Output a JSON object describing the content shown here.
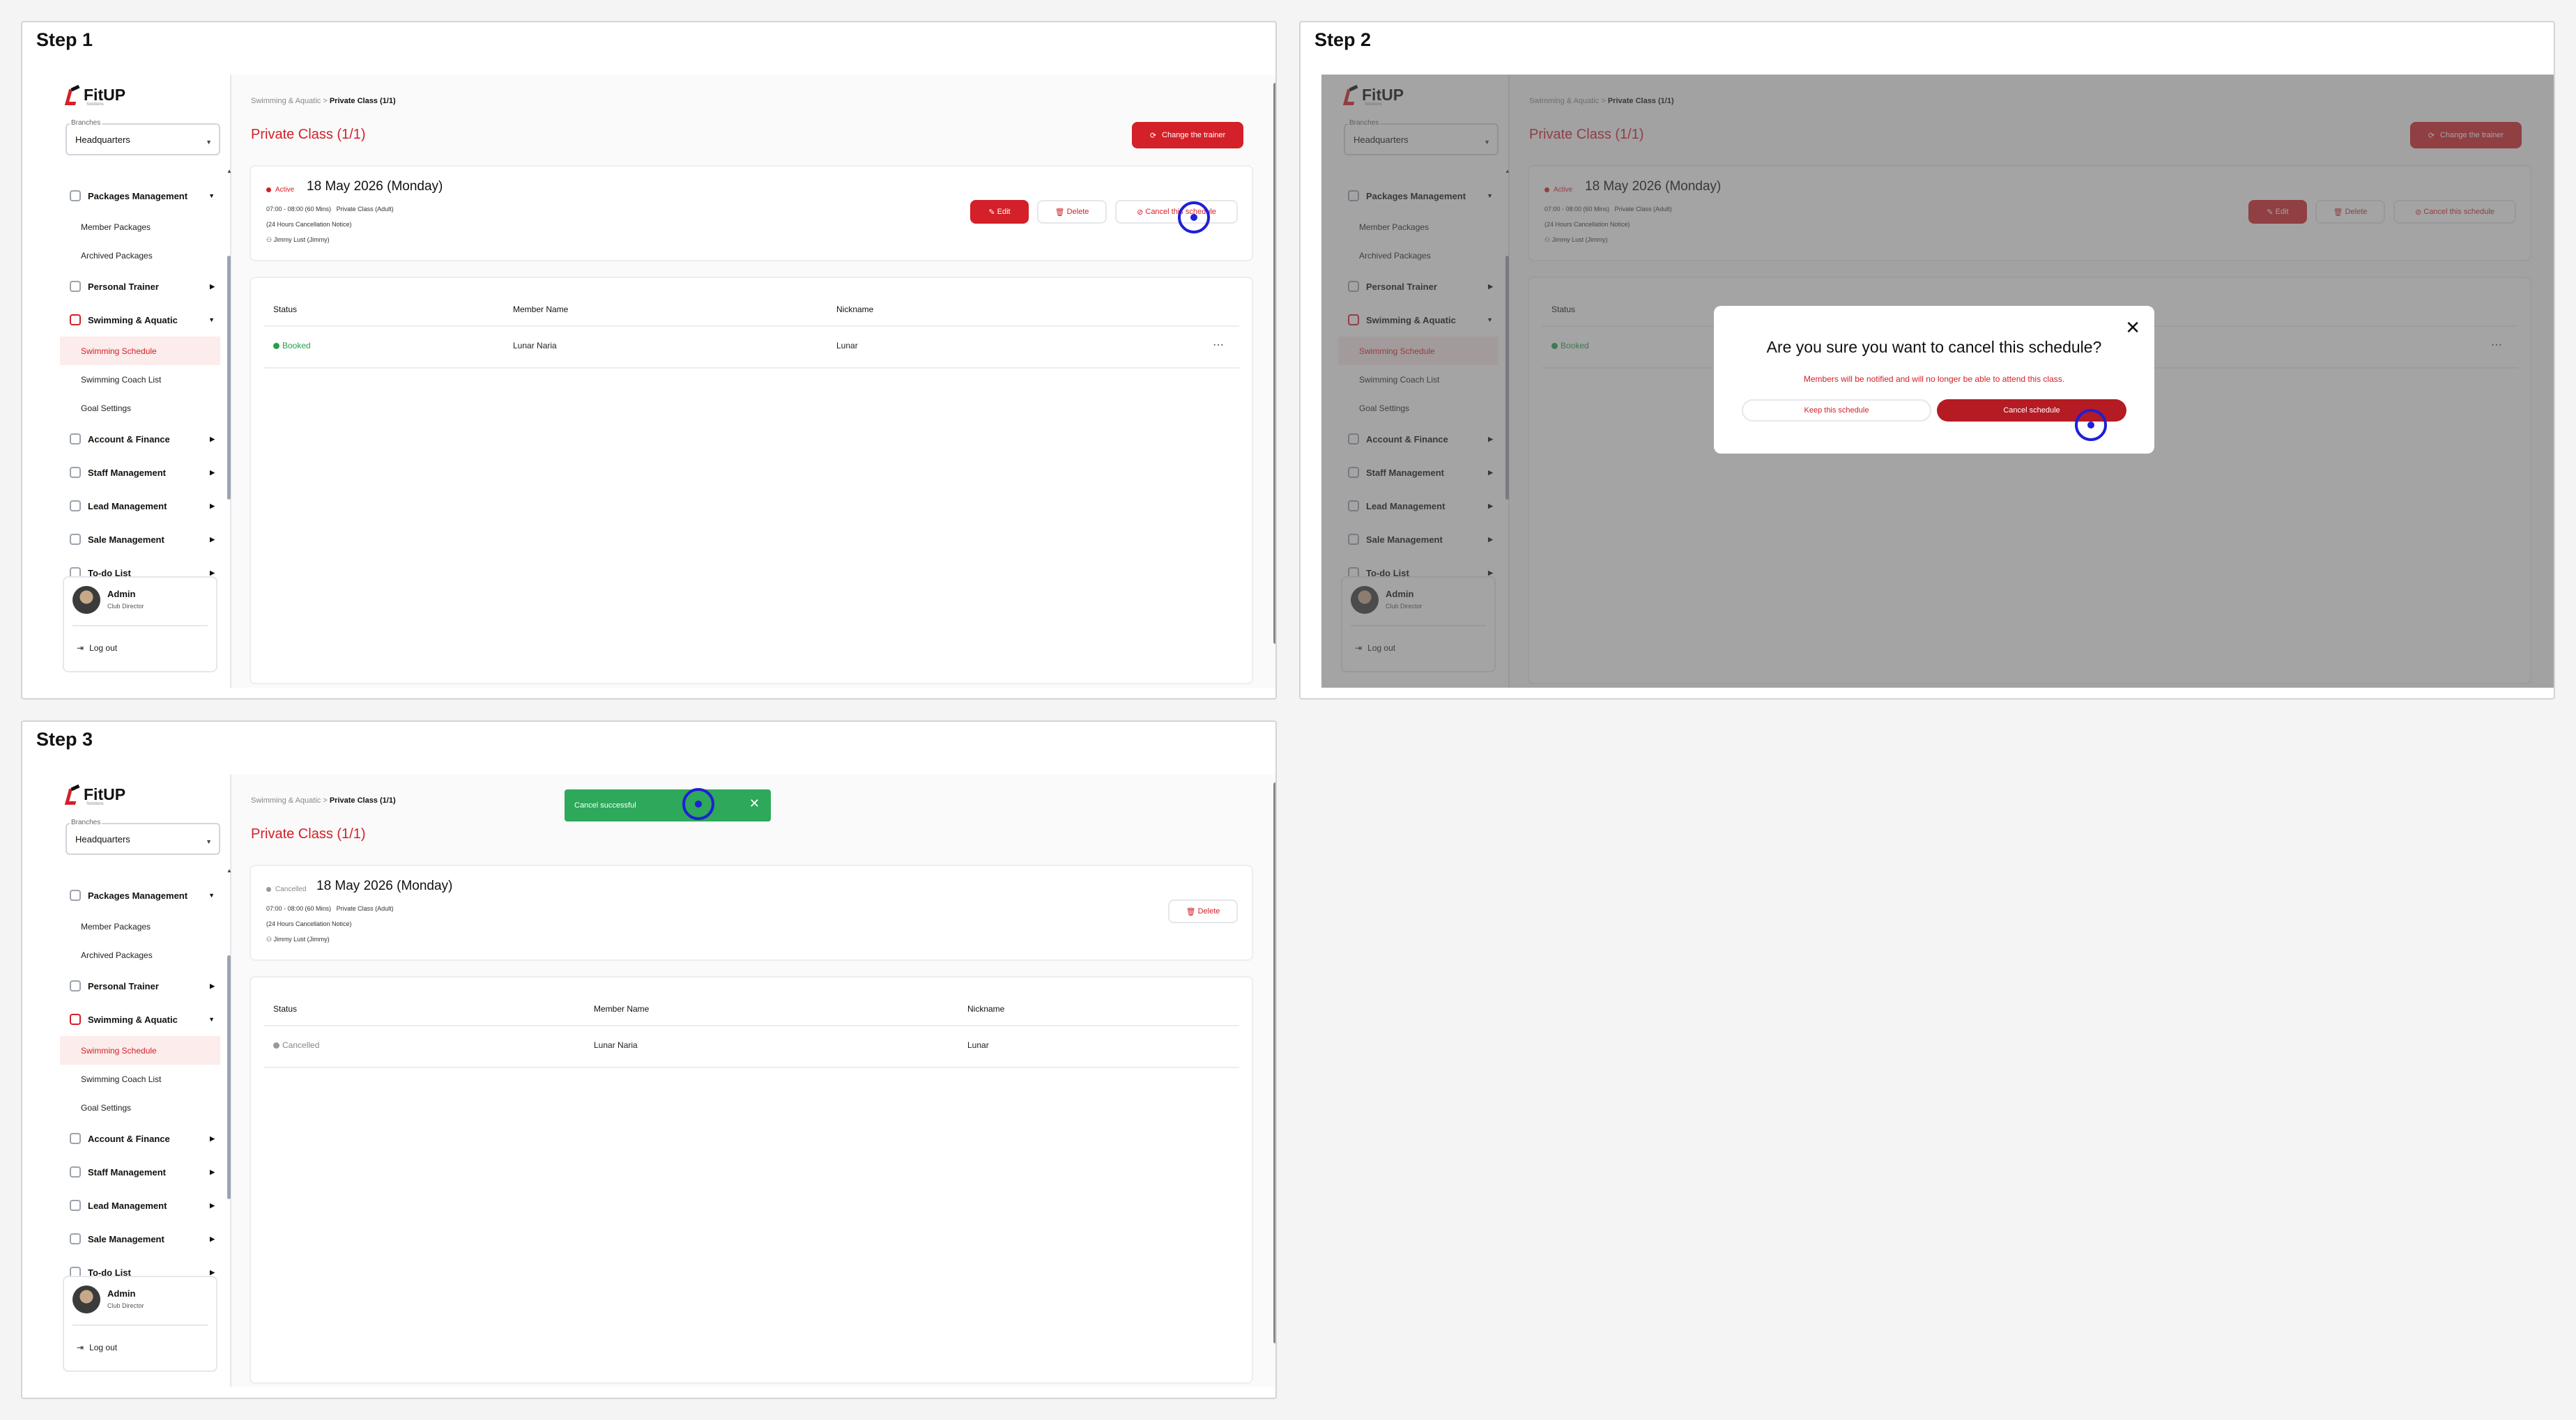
{
  "steps": [
    {
      "title": "Step 1"
    },
    {
      "title": "Step 2"
    },
    {
      "title": "Step 3"
    }
  ],
  "brand": {
    "name": "FitUP",
    "tagline": "Solutions"
  },
  "branch": {
    "label": "Branches",
    "value": "Headquarters"
  },
  "menu": {
    "packages": "Packages Management",
    "member_packages": "Member Packages",
    "archived_packages": "Archived Packages",
    "personal_trainer": "Personal Trainer",
    "swimming": "Swimming & Aquatic",
    "swimming_schedule": "Swimming Schedule",
    "swimming_coach": "Swimming Coach List",
    "goal_settings": "Goal Settings",
    "account": "Account & Finance",
    "staff": "Staff Management",
    "lead": "Lead Management",
    "sale": "Sale Management",
    "todo": "To-do List"
  },
  "profile": {
    "name": "Admin",
    "role": "Club Director",
    "logout": "Log out"
  },
  "breadcrumb": {
    "parent": "Swimming & Aquatic",
    "sep": ">",
    "current": "Private Class (1/1)"
  },
  "page_title": "Private Class (1/1)",
  "change_trainer": "Change the trainer",
  "schedule": {
    "status_active": "Active",
    "status_cancelled": "Cancelled",
    "date": "18 May 2026 (Monday)",
    "time": "07:00 - 08:00 (60 Mins)",
    "class_type": "Private Class (Adult)",
    "notice": "(24 Hours Cancellation Notice)",
    "trainer": "Jimmy Lust (Jimmy)"
  },
  "actions": {
    "edit": "Edit",
    "delete": "Delete",
    "cancel": "Cancel this schedule"
  },
  "table": {
    "headers": {
      "status": "Status",
      "member": "Member Name",
      "nickname": "Nickname"
    },
    "row": {
      "status_booked": "Booked",
      "status_cancelled": "Cancelled",
      "member": "Lunar Naria",
      "nickname": "Lunar"
    }
  },
  "modal": {
    "title": "Are you sure you want to cancel this schedule?",
    "subtitle": "Members will be notified and will no longer be able to attend this class.",
    "keep": "Keep this schedule",
    "confirm": "Cancel schedule"
  },
  "toast": {
    "message": "Cancel successful"
  },
  "colors": {
    "accent": "#d32029",
    "success": "#2ea85a",
    "cursor": "#1f1fd6"
  }
}
